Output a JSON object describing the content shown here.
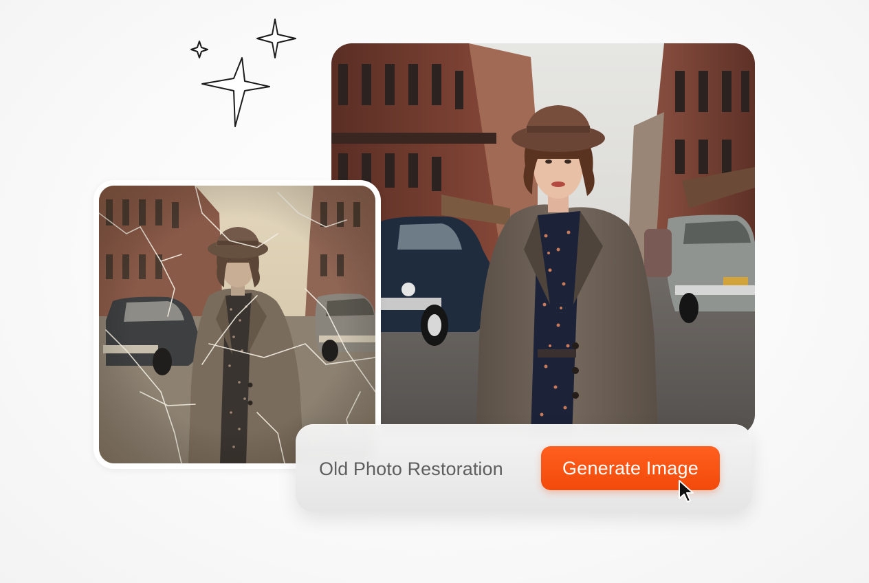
{
  "action_bar": {
    "label": "Old Photo Restoration",
    "button_label": "Generate Image"
  },
  "colors": {
    "accent": "#f24a0a",
    "background": "#fafafa",
    "label_text": "#5e5e5e"
  },
  "icons": {
    "sparkles": "sparkles-icon",
    "cursor": "mouse-pointer-icon"
  }
}
